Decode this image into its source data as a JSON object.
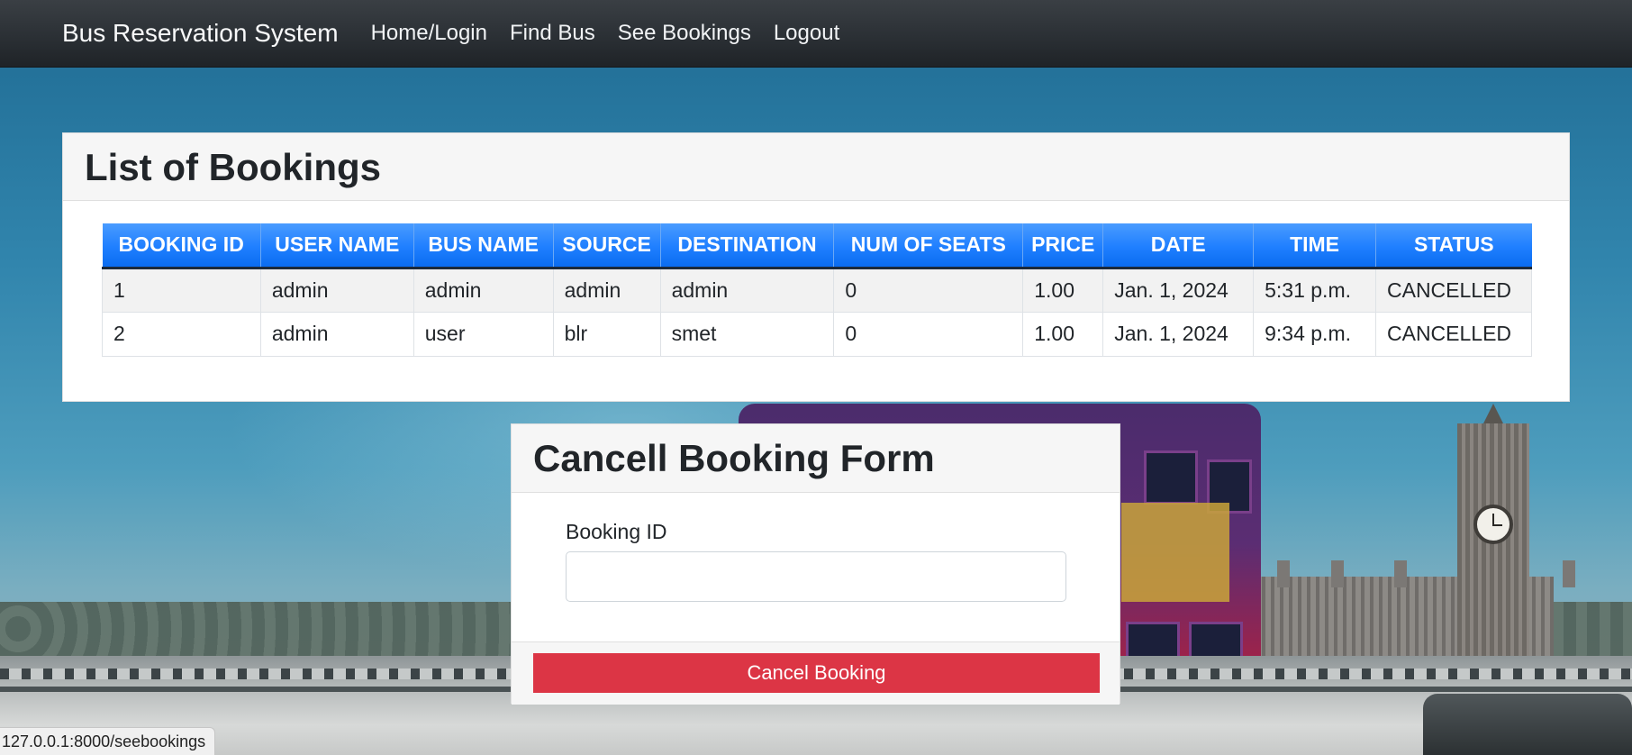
{
  "navbar": {
    "brand": "Bus Reservation System",
    "links": [
      "Home/Login",
      "Find Bus",
      "See Bookings",
      "Logout"
    ]
  },
  "bookings": {
    "title": "List of Bookings",
    "columns": [
      "BOOKING ID",
      "USER NAME",
      "BUS NAME",
      "SOURCE",
      "DESTINATION",
      "NUM OF SEATS",
      "PRICE",
      "DATE",
      "TIME",
      "STATUS"
    ],
    "rows": [
      [
        "1",
        "admin",
        "admin",
        "admin",
        "admin",
        "0",
        "1.00",
        "Jan. 1, 2024",
        "5:31 p.m.",
        "CANCELLED"
      ],
      [
        "2",
        "admin",
        "user",
        "blr",
        "smet",
        "0",
        "1.00",
        "Jan. 1, 2024",
        "9:34 p.m.",
        "CANCELLED"
      ]
    ]
  },
  "cancel_form": {
    "title": "Cancell Booking Form",
    "field_label": "Booking ID",
    "field_value": "",
    "submit_label": "Cancel Booking"
  },
  "status_bar": {
    "url": "127.0.0.1:8000/seebookings"
  },
  "colors": {
    "navbar": "#2b3035",
    "table_header": "#1f7fff",
    "danger": "#dc3545"
  }
}
